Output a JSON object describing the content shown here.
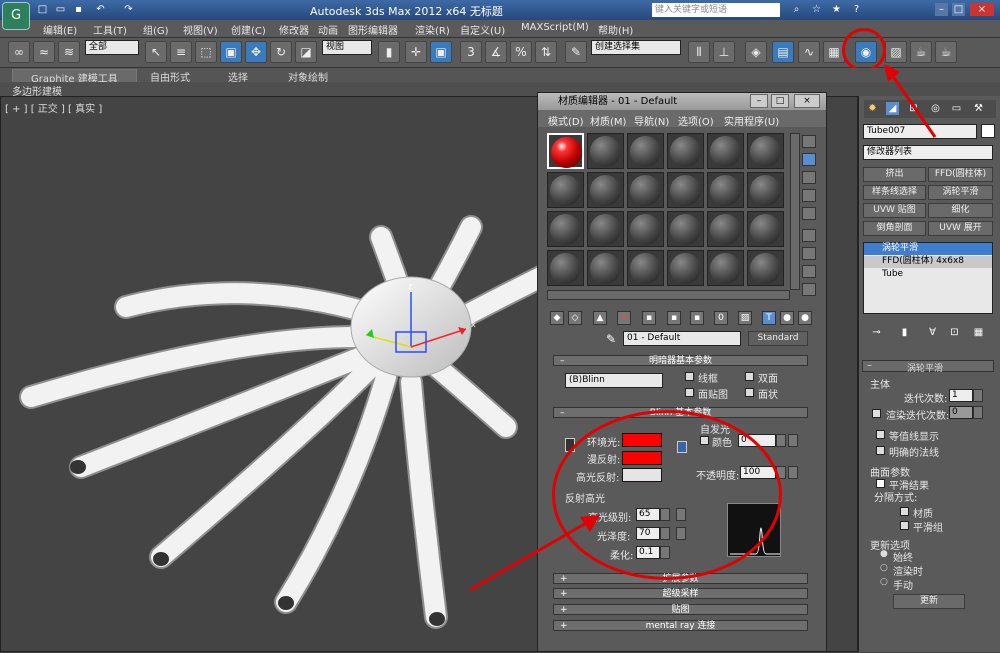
{
  "title_bar": {
    "app_title": "Autodesk 3ds Max  2012 x64",
    "doc_title": "无标题",
    "search_placeholder": "键入关键字或短语"
  },
  "menu": [
    "编辑(E)",
    "工具(T)",
    "组(G)",
    "视图(V)",
    "创建(C)",
    "修改器",
    "动画",
    "图形编辑器",
    "渲染(R)",
    "自定义(U)",
    "MAXScript(M)",
    "帮助(H)"
  ],
  "toolbar": {
    "selection_filter": "全部",
    "ref_coord": "视图",
    "named_selection": "创建选择集"
  },
  "ribbon": {
    "tabs": [
      "Graphite 建模工具",
      "自由形式",
      "选择",
      "对象绘制"
    ],
    "sub": "多边形建模"
  },
  "viewport": {
    "label": "[ + ] [ 正交 ] [ 真实 ]"
  },
  "material_editor": {
    "title": "材质编辑器 - 01 - Default",
    "menu": [
      "模式(D)",
      "材质(M)",
      "导航(N)",
      "选项(O)",
      "实用程序(U)"
    ],
    "material_name": "01 - Default",
    "material_type": "Standard",
    "shader_rollout": {
      "title": "明暗器基本参数",
      "shader": "(B)Blinn",
      "options": [
        "线框",
        "双面",
        "面贴图",
        "面状"
      ]
    },
    "basic_rollout": {
      "title": "Blinn 基本参数",
      "self_illum_title": "自发光",
      "color_label": "颜色",
      "color_value": "0",
      "ambient": "环境光:",
      "diffuse": "漫反射:",
      "specular": "高光反射:",
      "opacity_label": "不透明度:",
      "opacity_value": "100",
      "spec_hl_title": "反射高光",
      "spec_level_label": "高光级别:",
      "spec_level": "65",
      "gloss_label": "光泽度:",
      "gloss": "70",
      "soften_label": "柔化:",
      "soften": "0.1",
      "ambient_color": "#ff0000",
      "diffuse_color": "#ff0000",
      "specular_color": "#e5e5e5"
    },
    "rollouts": [
      "扩展参数",
      "超级采样",
      "贴图",
      "mental ray 连接"
    ]
  },
  "command_panel": {
    "object_name": "Tube007",
    "modifier_list": "修改器列表",
    "buttons": [
      "挤出",
      "FFD(圆柱体)",
      "样条线选择",
      "涡轮平滑",
      "UVW 贴图",
      "细化",
      "倒角剖面",
      "UVW 展开"
    ],
    "stack": [
      "涡轮平滑",
      "FFD(圆柱体) 4x6x8",
      "Tube"
    ],
    "turbosmooth": {
      "title": "涡轮平滑",
      "main": "主体",
      "iterations_label": "迭代次数:",
      "iterations": "1",
      "render_iters_label": "渲染迭代次数:",
      "render_iters": "0",
      "isoline": "等值线显示",
      "explicit_normals": "明确的法线",
      "surface_params": "曲面参数",
      "smooth_result": "平滑结果",
      "separate_by": "分隔方式:",
      "materials": "材质",
      "smoothing_groups": "平滑组",
      "update_options": "更新选项",
      "always": "始终",
      "when_rendering": "渲染时",
      "manually": "手动",
      "update": "更新"
    }
  },
  "accent": "#e30000"
}
